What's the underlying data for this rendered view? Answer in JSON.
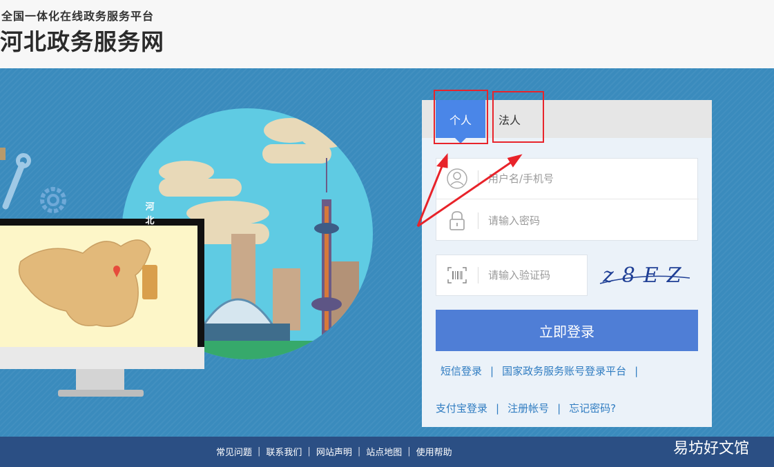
{
  "header": {
    "tagline": "全国一体化在线政务服务平台",
    "site_title": "河北政务服务网"
  },
  "illustration": {
    "map_label": "河北"
  },
  "login": {
    "tabs": [
      {
        "label": "个人",
        "active": true
      },
      {
        "label": "法人",
        "active": false
      }
    ],
    "username_placeholder": "用户名/手机号",
    "password_placeholder": "请输入密码",
    "captcha_placeholder": "请输入验证码",
    "captcha_text": "z8EZ",
    "submit_label": "立即登录",
    "links_row1": [
      "短信登录",
      "国家政务服务账号登录平台"
    ],
    "links_row2": [
      "支付宝登录",
      "注册帐号",
      "忘记密码?"
    ]
  },
  "footer": {
    "links": [
      "常见问题",
      "联系我们",
      "网站声明",
      "站点地图",
      "使用帮助"
    ]
  },
  "watermark": "易坊好文馆",
  "colors": {
    "banner": "#3a8bbd",
    "active_tab": "#4a86e8",
    "login_button": "#4f7ed6",
    "link": "#2f7cc1",
    "footer": "#2b4f84",
    "annotation": "#e8232a"
  }
}
